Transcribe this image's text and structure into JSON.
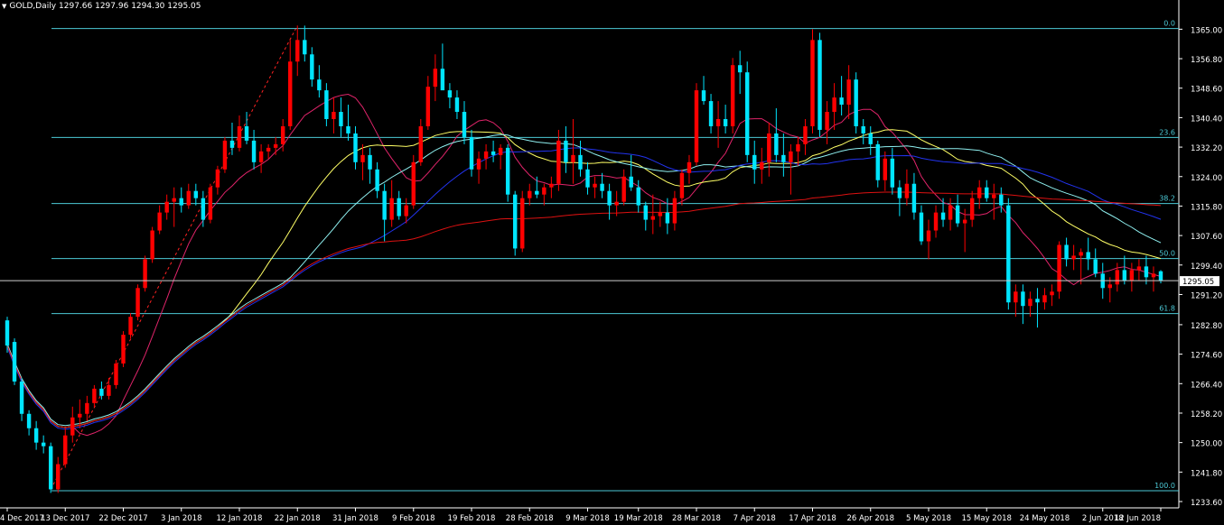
{
  "header": {
    "symbol_timeframe": "GOLD,Daily",
    "ohlc": "1297.66 1297.96 1294.30 1295.05",
    "menu_glyph": "▼"
  },
  "colors": {
    "background": "#000000",
    "bull_candle": "#ff0000",
    "bear_candle": "#00e5ff",
    "fib_line": "#4cc9d6",
    "ma_fast": "#e0246a",
    "ma_yellow": "#ffff66",
    "ma_cyan": "#8ff0f0",
    "ma_blue": "#2233ee",
    "ma_long": "#dd1111",
    "price_label_bg": "#ffffff",
    "axis_text": "#ffffff"
  },
  "chart_data": {
    "type": "candlestick",
    "symbol": "GOLD",
    "timeframe": "Daily",
    "ylim": [
      1233.6,
      1366.6
    ],
    "y_ticks": [
      "1365.00",
      "1356.80",
      "1348.60",
      "1340.40",
      "1332.20",
      "1324.00",
      "1315.80",
      "1307.60",
      "1299.40",
      "1291.20",
      "1282.80",
      "1274.60",
      "1266.40",
      "1258.20",
      "1250.00",
      "1241.80",
      "1233.60"
    ],
    "x_ticks": [
      "4 Dec 2017",
      "13 Dec 2017",
      "22 Dec 2017",
      "3 Jan 2018",
      "12 Jan 2018",
      "22 Jan 2018",
      "31 Jan 2018",
      "9 Feb 2018",
      "19 Feb 2018",
      "28 Feb 2018",
      "9 Mar 2018",
      "19 Mar 2018",
      "28 Mar 2018",
      "7 Apr 2018",
      "17 Apr 2018",
      "26 Apr 2018",
      "5 May 2018",
      "15 May 2018",
      "24 May 2018",
      "2 Jun 2018",
      "12 Jun 2018"
    ],
    "current_price": "1295.05",
    "current_price_value": 1295.05,
    "fibonacci": [
      {
        "label": "0.0",
        "price": 1365.2
      },
      {
        "label": "23.6",
        "price": 1334.9
      },
      {
        "label": "38.2",
        "price": 1316.5
      },
      {
        "label": "50.0",
        "price": 1301.2
      },
      {
        "label": "61.8",
        "price": 1285.9
      },
      {
        "label": "100.0",
        "price": 1236.6
      }
    ],
    "fib_trendline": {
      "from": [
        "12 Dec 2017",
        1237
      ],
      "to": [
        "22 Jan 2018",
        1366
      ]
    },
    "candles": [
      [
        1284,
        1285,
        1275,
        1277
      ],
      [
        1278,
        1279,
        1266,
        1267
      ],
      [
        1267,
        1268,
        1256,
        1258
      ],
      [
        1258,
        1259,
        1252,
        1254
      ],
      [
        1254,
        1256,
        1248,
        1250
      ],
      [
        1250,
        1252,
        1247,
        1249
      ],
      [
        1249,
        1250,
        1236,
        1237
      ],
      [
        1237,
        1246,
        1236,
        1244
      ],
      [
        1244,
        1254,
        1243,
        1252
      ],
      [
        1252,
        1260,
        1250,
        1257
      ],
      [
        1257,
        1262,
        1254,
        1258
      ],
      [
        1258,
        1263,
        1256,
        1261
      ],
      [
        1261,
        1266,
        1260,
        1265
      ],
      [
        1265,
        1267,
        1262,
        1263
      ],
      [
        1263,
        1268,
        1262,
        1266
      ],
      [
        1266,
        1273,
        1265,
        1272
      ],
      [
        1272,
        1281,
        1271,
        1280
      ],
      [
        1280,
        1286,
        1279,
        1285
      ],
      [
        1285,
        1294,
        1284,
        1293
      ],
      [
        1293,
        1302,
        1292,
        1301
      ],
      [
        1301,
        1310,
        1300,
        1309
      ],
      [
        1309,
        1316,
        1308,
        1314
      ],
      [
        1314,
        1319,
        1312,
        1317
      ],
      [
        1317,
        1321,
        1310,
        1318
      ],
      [
        1318,
        1321,
        1314,
        1316
      ],
      [
        1316,
        1322,
        1315,
        1320
      ],
      [
        1320,
        1322,
        1316,
        1318
      ],
      [
        1318,
        1320,
        1310,
        1312
      ],
      [
        1312,
        1322,
        1311,
        1321
      ],
      [
        1321,
        1327,
        1319,
        1326
      ],
      [
        1326,
        1335,
        1325,
        1334
      ],
      [
        1334,
        1339,
        1330,
        1332
      ],
      [
        1332,
        1341,
        1331,
        1338
      ],
      [
        1338,
        1342,
        1333,
        1334
      ],
      [
        1334,
        1337,
        1326,
        1328
      ],
      [
        1328,
        1333,
        1325,
        1331
      ],
      [
        1331,
        1333,
        1329,
        1332
      ],
      [
        1332,
        1335,
        1330,
        1333
      ],
      [
        1333,
        1340,
        1331,
        1338
      ],
      [
        1338,
        1362,
        1337,
        1356
      ],
      [
        1356,
        1366,
        1352,
        1362
      ],
      [
        1362,
        1366,
        1356,
        1358
      ],
      [
        1358,
        1360,
        1349,
        1351
      ],
      [
        1351,
        1355,
        1346,
        1348
      ],
      [
        1348,
        1350,
        1338,
        1340
      ],
      [
        1340,
        1346,
        1336,
        1342
      ],
      [
        1342,
        1346,
        1335,
        1338
      ],
      [
        1338,
        1344,
        1334,
        1336
      ],
      [
        1336,
        1338,
        1326,
        1328
      ],
      [
        1328,
        1333,
        1323,
        1330
      ],
      [
        1330,
        1332,
        1322,
        1326
      ],
      [
        1326,
        1328,
        1318,
        1320
      ],
      [
        1320,
        1322,
        1306,
        1312
      ],
      [
        1312,
        1323,
        1310,
        1318
      ],
      [
        1318,
        1320,
        1312,
        1313
      ],
      [
        1313,
        1318,
        1311,
        1316
      ],
      [
        1316,
        1330,
        1315,
        1328
      ],
      [
        1328,
        1340,
        1327,
        1338
      ],
      [
        1338,
        1352,
        1337,
        1349
      ],
      [
        1349,
        1358,
        1345,
        1354
      ],
      [
        1354,
        1361,
        1349,
        1348
      ],
      [
        1348,
        1350,
        1343,
        1346
      ],
      [
        1346,
        1348,
        1340,
        1342
      ],
      [
        1342,
        1345,
        1333,
        1335
      ],
      [
        1335,
        1337,
        1324,
        1326
      ],
      [
        1326,
        1331,
        1322,
        1329
      ],
      [
        1329,
        1333,
        1326,
        1331
      ],
      [
        1331,
        1334,
        1328,
        1330
      ],
      [
        1330,
        1333,
        1326,
        1332
      ],
      [
        1332,
        1333,
        1317,
        1319
      ],
      [
        1319,
        1320,
        1302,
        1304
      ],
      [
        1304,
        1320,
        1303,
        1318
      ],
      [
        1318,
        1322,
        1316,
        1320
      ],
      [
        1320,
        1324,
        1318,
        1319
      ],
      [
        1319,
        1322,
        1316,
        1321
      ],
      [
        1321,
        1324,
        1318,
        1322
      ],
      [
        1322,
        1337,
        1320,
        1334
      ],
      [
        1334,
        1338,
        1325,
        1328
      ],
      [
        1328,
        1340,
        1322,
        1330
      ],
      [
        1330,
        1334,
        1324,
        1326
      ],
      [
        1326,
        1328,
        1319,
        1321
      ],
      [
        1321,
        1324,
        1318,
        1322
      ],
      [
        1322,
        1325,
        1318,
        1320
      ],
      [
        1320,
        1322,
        1312,
        1316
      ],
      [
        1316,
        1320,
        1313,
        1317
      ],
      [
        1317,
        1326,
        1316,
        1324
      ],
      [
        1324,
        1330,
        1320,
        1321
      ],
      [
        1321,
        1323,
        1314,
        1316
      ],
      [
        1316,
        1317,
        1309,
        1312
      ],
      [
        1312,
        1319,
        1308,
        1313
      ],
      [
        1313,
        1317,
        1310,
        1314
      ],
      [
        1314,
        1318,
        1308,
        1311
      ],
      [
        1311,
        1320,
        1309,
        1318
      ],
      [
        1318,
        1326,
        1316,
        1325
      ],
      [
        1325,
        1330,
        1322,
        1328
      ],
      [
        1328,
        1350,
        1327,
        1348
      ],
      [
        1348,
        1352,
        1344,
        1345
      ],
      [
        1345,
        1347,
        1336,
        1338
      ],
      [
        1338,
        1345,
        1332,
        1340
      ],
      [
        1340,
        1344,
        1336,
        1338
      ],
      [
        1338,
        1357,
        1336,
        1355
      ],
      [
        1355,
        1359,
        1347,
        1353
      ],
      [
        1353,
        1356,
        1328,
        1330
      ],
      [
        1330,
        1334,
        1322,
        1326
      ],
      [
        1326,
        1332,
        1322,
        1328
      ],
      [
        1328,
        1339,
        1324,
        1336
      ],
      [
        1336,
        1343,
        1328,
        1330
      ],
      [
        1330,
        1336,
        1324,
        1328
      ],
      [
        1328,
        1333,
        1319,
        1331
      ],
      [
        1331,
        1335,
        1327,
        1333
      ],
      [
        1333,
        1340,
        1330,
        1338
      ],
      [
        1338,
        1365,
        1336,
        1362
      ],
      [
        1362,
        1364,
        1335,
        1337
      ],
      [
        1337,
        1345,
        1333,
        1342
      ],
      [
        1342,
        1350,
        1337,
        1346
      ],
      [
        1346,
        1352,
        1341,
        1344
      ],
      [
        1344,
        1355,
        1340,
        1351
      ],
      [
        1351,
        1353,
        1336,
        1338
      ],
      [
        1338,
        1340,
        1333,
        1336
      ],
      [
        1336,
        1338,
        1330,
        1333
      ],
      [
        1333,
        1334,
        1321,
        1323
      ],
      [
        1323,
        1331,
        1320,
        1329
      ],
      [
        1329,
        1332,
        1319,
        1321
      ],
      [
        1321,
        1323,
        1313,
        1318
      ],
      [
        1318,
        1326,
        1316,
        1322
      ],
      [
        1322,
        1325,
        1312,
        1314
      ],
      [
        1314,
        1316,
        1305,
        1306
      ],
      [
        1306,
        1312,
        1301,
        1309
      ],
      [
        1309,
        1316,
        1307,
        1314
      ],
      [
        1314,
        1318,
        1310,
        1312
      ],
      [
        1312,
        1318,
        1309,
        1316
      ],
      [
        1316,
        1319,
        1310,
        1311
      ],
      [
        1311,
        1315,
        1303,
        1312
      ],
      [
        1312,
        1320,
        1310,
        1318
      ],
      [
        1318,
        1323,
        1315,
        1321
      ],
      [
        1321,
        1323,
        1317,
        1318
      ],
      [
        1318,
        1322,
        1312,
        1319
      ],
      [
        1319,
        1321,
        1314,
        1316
      ],
      [
        1316,
        1318,
        1287,
        1289
      ],
      [
        1289,
        1294,
        1285,
        1292
      ],
      [
        1292,
        1294,
        1283,
        1288
      ],
      [
        1288,
        1292,
        1285,
        1290
      ],
      [
        1290,
        1293,
        1282,
        1289
      ],
      [
        1289,
        1293,
        1287,
        1291
      ],
      [
        1291,
        1294,
        1288,
        1292
      ],
      [
        1292,
        1306,
        1290,
        1305
      ],
      [
        1305,
        1307,
        1299,
        1301
      ],
      [
        1301,
        1305,
        1298,
        1302
      ],
      [
        1302,
        1304,
        1294,
        1303
      ],
      [
        1303,
        1307,
        1298,
        1301
      ],
      [
        1301,
        1304,
        1296,
        1297
      ],
      [
        1297,
        1300,
        1290,
        1293
      ],
      [
        1293,
        1296,
        1289,
        1294
      ],
      [
        1294,
        1300,
        1292,
        1298
      ],
      [
        1298,
        1302,
        1294,
        1295
      ],
      [
        1295,
        1300,
        1292,
        1298
      ],
      [
        1298,
        1301,
        1295,
        1299
      ],
      [
        1299,
        1302,
        1294,
        1296
      ],
      [
        1296,
        1299,
        1292,
        1297
      ],
      [
        1297.66,
        1297.96,
        1294.3,
        1295.05
      ]
    ]
  }
}
